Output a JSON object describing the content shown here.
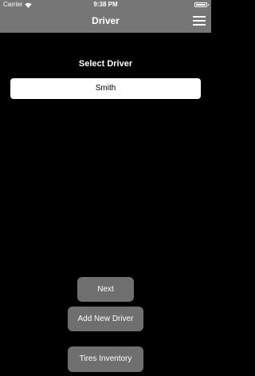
{
  "status_bar": {
    "carrier": "Carrier",
    "time": "9:38 PM",
    "wifi_icon": "wifi-icon",
    "battery_icon": "battery-icon",
    "battery_level": 1.0
  },
  "nav": {
    "title": "Driver",
    "menu_icon": "hamburger-menu-icon"
  },
  "main": {
    "select_label": "Select Driver",
    "driver_value": "Smith"
  },
  "buttons": {
    "next": "Next",
    "add_new_driver": "Add New Driver",
    "tires_inventory": "Tires Inventory"
  },
  "colors": {
    "background": "#000000",
    "bar": "#767676",
    "button": "#6f6f6f",
    "field": "#ffffff"
  }
}
